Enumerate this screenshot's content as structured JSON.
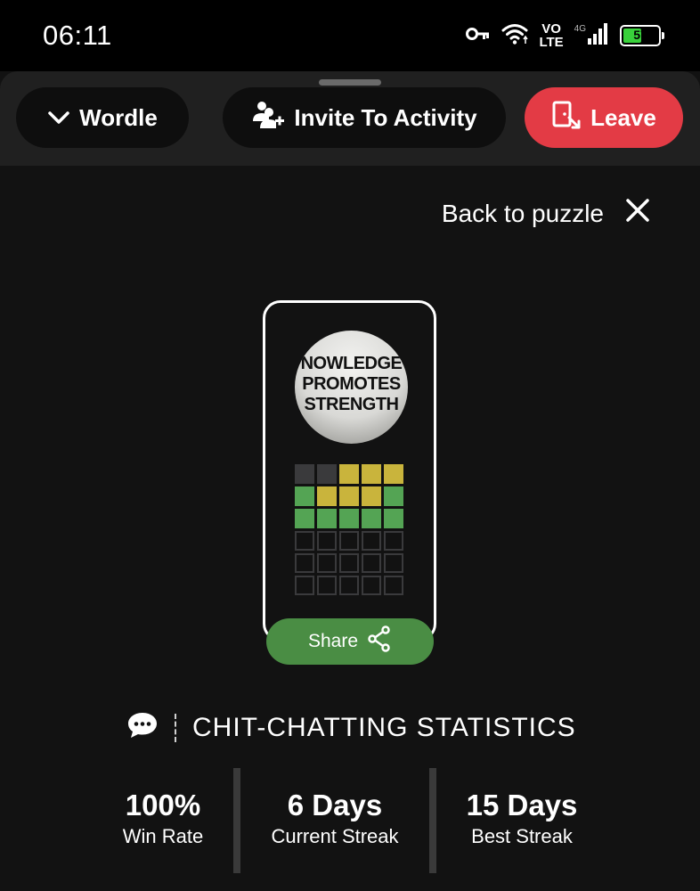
{
  "status_bar": {
    "time": "06:11",
    "network_top": "VO",
    "network_bottom": "LTE",
    "network_small": "4G",
    "battery_level": "57",
    "battery_fraction": 0.57,
    "icons": [
      "key-icon",
      "wifi-icon",
      "signal-icon",
      "battery-icon"
    ]
  },
  "activity_bar": {
    "wordle_label": "Wordle",
    "invite_label": "Invite To Activity",
    "leave_label": "Leave",
    "leave_color": "#e33b45"
  },
  "main": {
    "back_label": "Back to puzzle",
    "avatar_lines": [
      "NOWLEDGE",
      "PROMOTES",
      "STRENGTH"
    ],
    "grid": [
      [
        "gray",
        "gray",
        "yellow",
        "yellow",
        "yellow"
      ],
      [
        "green",
        "yellow",
        "yellow",
        "yellow",
        "green"
      ],
      [
        "green",
        "green",
        "green",
        "green",
        "green"
      ],
      [
        "empty",
        "empty",
        "empty",
        "empty",
        "empty"
      ],
      [
        "empty",
        "empty",
        "empty",
        "empty",
        "empty"
      ],
      [
        "empty",
        "empty",
        "empty",
        "empty",
        "empty"
      ]
    ],
    "share_label": "Share"
  },
  "stats": {
    "title": "CHIT-CHATTING STATISTICS",
    "items": [
      {
        "value": "100%",
        "label": "Win Rate"
      },
      {
        "value": "6 Days",
        "label": "Current Streak"
      },
      {
        "value": "15 Days",
        "label": "Best Streak"
      }
    ]
  },
  "colors": {
    "green": "#54a454",
    "yellow": "#c9b43c",
    "gray": "#3a3a3c",
    "share": "#4a8d44"
  }
}
